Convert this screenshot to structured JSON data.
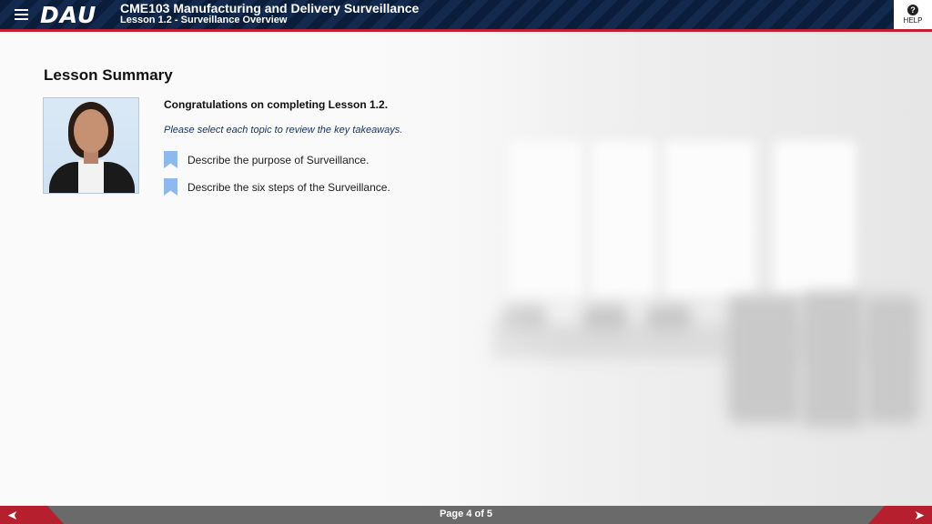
{
  "header": {
    "logo": "DAU",
    "course_title": "CME103 Manufacturing and Delivery Surveillance",
    "lesson_title": "Lesson 1.2 - Surveillance Overview",
    "help_label": "HELP",
    "help_symbol": "?"
  },
  "main": {
    "heading": "Lesson Summary",
    "congrats": "Congratulations on completing Lesson 1.2.",
    "instruction": "Please select each topic to review the key takeaways.",
    "topics": [
      {
        "label": "Describe the purpose of Surveillance."
      },
      {
        "label": "Describe the six steps of the Surveillance."
      }
    ]
  },
  "footer": {
    "page_indicator": "Page 4 of 5",
    "prev_symbol": "➤",
    "next_symbol": "➤"
  },
  "colors": {
    "header_bg": "#0a1d3b",
    "accent_red": "#c21f33",
    "footer_bg": "#6a6a6a",
    "bookmark": "#8fb8ec",
    "instruction_text": "#1b3560"
  }
}
